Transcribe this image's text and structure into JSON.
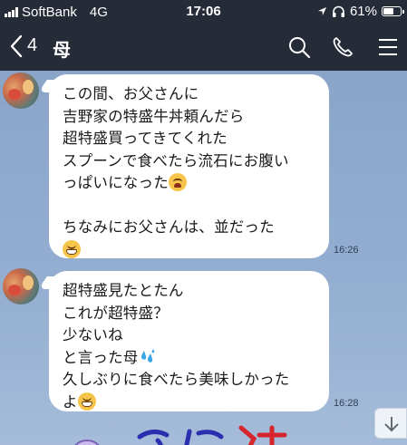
{
  "status_bar": {
    "carrier": "SoftBank",
    "network": "4G",
    "time": "17:06",
    "battery_percent": "61%",
    "battery_level": 0.61
  },
  "header": {
    "unread_count": "4",
    "title": "母",
    "icons": [
      "back-chevron-icon",
      "search-icon",
      "phone-icon",
      "menu-icon"
    ]
  },
  "messages": [
    {
      "sender": "母",
      "time": "16:26",
      "lines": [
        "この間、お父さんに",
        "吉野家の特盛牛丼頼んだら",
        "超特盛買ってきてくれた",
        "スプーンで食べたら流石にお腹い",
        "っぱいになった",
        "",
        "ちなみにお父さんは、並だった",
        ""
      ]
    },
    {
      "sender": "母",
      "time": "16:28",
      "lines": [
        "超特盛見たとたん",
        "これが超特盛？",
        "少ないね",
        "と言った母",
        "久しぶりに食べたら美味しかった",
        "よ"
      ]
    }
  ],
  "colors": {
    "header_bg": "#262b38",
    "chat_bg": "#8ea9cc",
    "bubble_bg": "#ffffff",
    "timestamp": "#2e3f55"
  }
}
